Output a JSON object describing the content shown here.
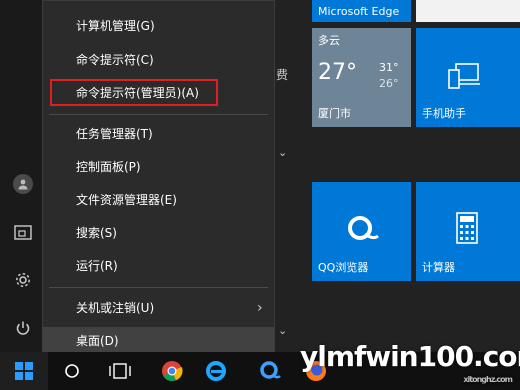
{
  "context_menu": {
    "items": [
      {
        "label": "计算机管理(G)"
      },
      {
        "label": "命令提示符(C)"
      },
      {
        "label": "命令提示符(管理员)(A)"
      },
      {
        "label": "任务管理器(T)"
      },
      {
        "label": "控制面板(P)"
      },
      {
        "label": "文件资源管理器(E)"
      },
      {
        "label": "搜索(S)"
      },
      {
        "label": "运行(R)"
      },
      {
        "label": "关机或注销(U)"
      },
      {
        "label": "桌面(D)"
      }
    ],
    "submenu_arrow": "›"
  },
  "tiles": {
    "edge": {
      "label": "Microsoft Edge"
    },
    "weather": {
      "condition": "多云",
      "temp": "27°",
      "high": "31°",
      "low": "26°",
      "city": "厦门市"
    },
    "phone": {
      "label": "手机助手",
      "icon": "phone-laptop-icon"
    },
    "qq_browser": {
      "label": "QQ浏览器",
      "icon": "qq-browser-icon"
    },
    "calculator": {
      "label": "计算器",
      "icon": "calculator-icon"
    }
  },
  "side": {
    "fee_char": "费"
  },
  "watermark": {
    "text": "ylmfwin100.com",
    "sub": "xitonghz.com"
  },
  "colors": {
    "tile_blue": "#0078d7",
    "highlight_red": "#e02020",
    "weather_gray": "#6e8597"
  }
}
